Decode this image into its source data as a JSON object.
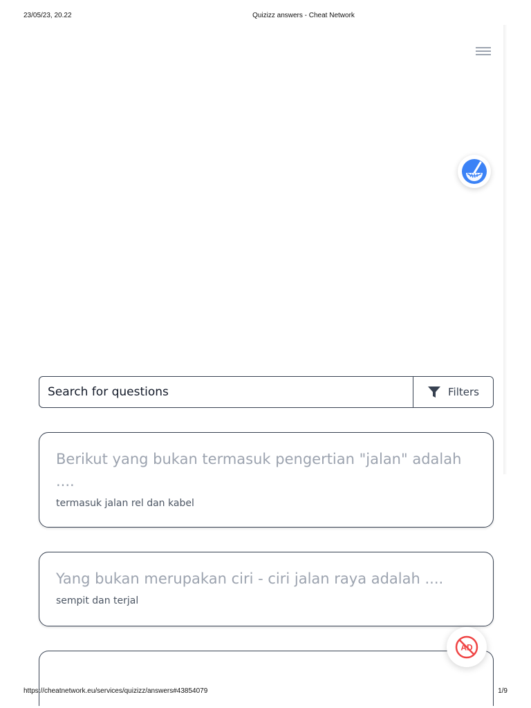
{
  "print_header": {
    "date": "23/05/23, 20.22",
    "title": "Quizizz answers - Cheat Network"
  },
  "print_footer": {
    "url": "https://cheatnetwork.eu/services/quizizz/answers#43854079",
    "page": "1/9"
  },
  "nav": {
    "menu_icon": "hamburger-icon"
  },
  "fab": {
    "broom_icon": "broom-icon",
    "broom_color": "#3b82f6",
    "ad_icon": "ad-block-icon",
    "ad_label": "AD",
    "ad_color": "#ef4444"
  },
  "search": {
    "placeholder": "Search for questions",
    "filters_label": "Filters",
    "filters_icon": "funnel-icon"
  },
  "questions": [
    {
      "question": "Berikut yang bukan termasuk pengertian \"jalan\" adalah ....",
      "answer": "termasuk jalan rel dan kabel"
    },
    {
      "question": "Yang bukan merupakan ciri - ciri jalan raya adalah ....",
      "answer": "sempit dan terjal"
    }
  ]
}
